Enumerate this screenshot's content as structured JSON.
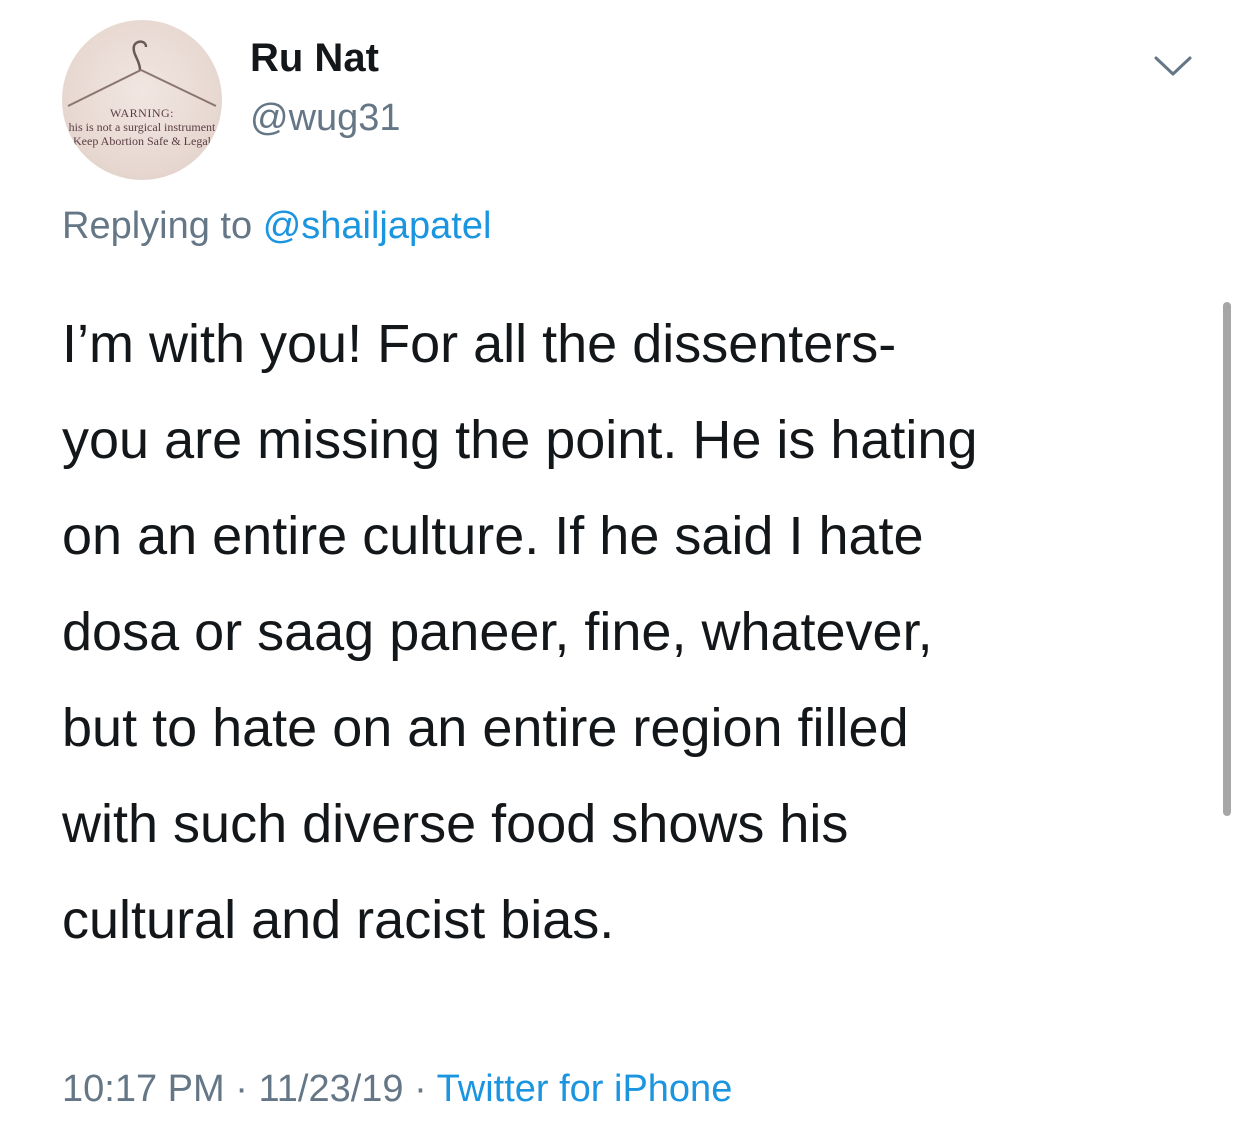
{
  "tweet": {
    "avatar": {
      "icon": "coat-hanger-icon",
      "warning": "WARNING:",
      "line1": "his is not a surgical instrument",
      "line2": "Keep Abortion Safe & Legal"
    },
    "display_name": "Ru Nat",
    "handle": "@wug31",
    "menu_icon": "chevron-down-icon",
    "reply": {
      "prefix": "Replying to",
      "to": "@shailjapatel"
    },
    "body_lines": [
      "I’m with you! For all the dissenters-",
      "you are missing the point. He is hating",
      "on an entire culture. If he said I hate",
      "dosa or saag paneer, fine, whatever,",
      "but to hate on an entire region filled",
      "with such diverse food shows his",
      "cultural and racist bias."
    ],
    "meta": {
      "time": "10:17 PM",
      "date": "11/23/19",
      "separator": "·",
      "source": "Twitter for iPhone"
    }
  },
  "colors": {
    "text": "#14171a",
    "secondary": "#657786",
    "link": "#1b95e0",
    "background": "#ffffff"
  }
}
